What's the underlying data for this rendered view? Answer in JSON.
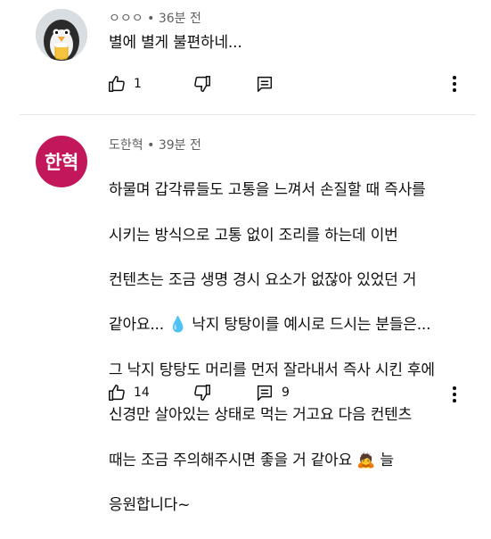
{
  "comments": [
    {
      "author": "ㅇㅇㅇ",
      "time": "36분 전",
      "text": "별에 별게 불편하네...",
      "likes": "1",
      "replies": ""
    },
    {
      "author": "도한혁",
      "avatar_text": "한혁",
      "avatar_color": "#c2185b",
      "time": "39분 전",
      "lines": [
        "하물며 갑각류들도 고통을 느껴서 손질할 때 즉사를",
        "시키는 방식으로 고통 없이 조리를 하는데 이번",
        "컨텐츠는 조금 생명 경시 요소가 없잖아 있었던 거",
        "같아요... 💧 낙지 탕탕이를 예시로 드시는 분들은...",
        "그 낙지 탕탕도 머리를 먼저 잘라내서 즉사 시킨 후에",
        "신경만 살아있는 상태로 먹는 거고요 다음 컨텐츠",
        "때는 조금 주의해주시면 좋을 거 같아요 🙇 늘",
        "응원합니다~"
      ],
      "likes": "14",
      "replies": "9"
    }
  ]
}
